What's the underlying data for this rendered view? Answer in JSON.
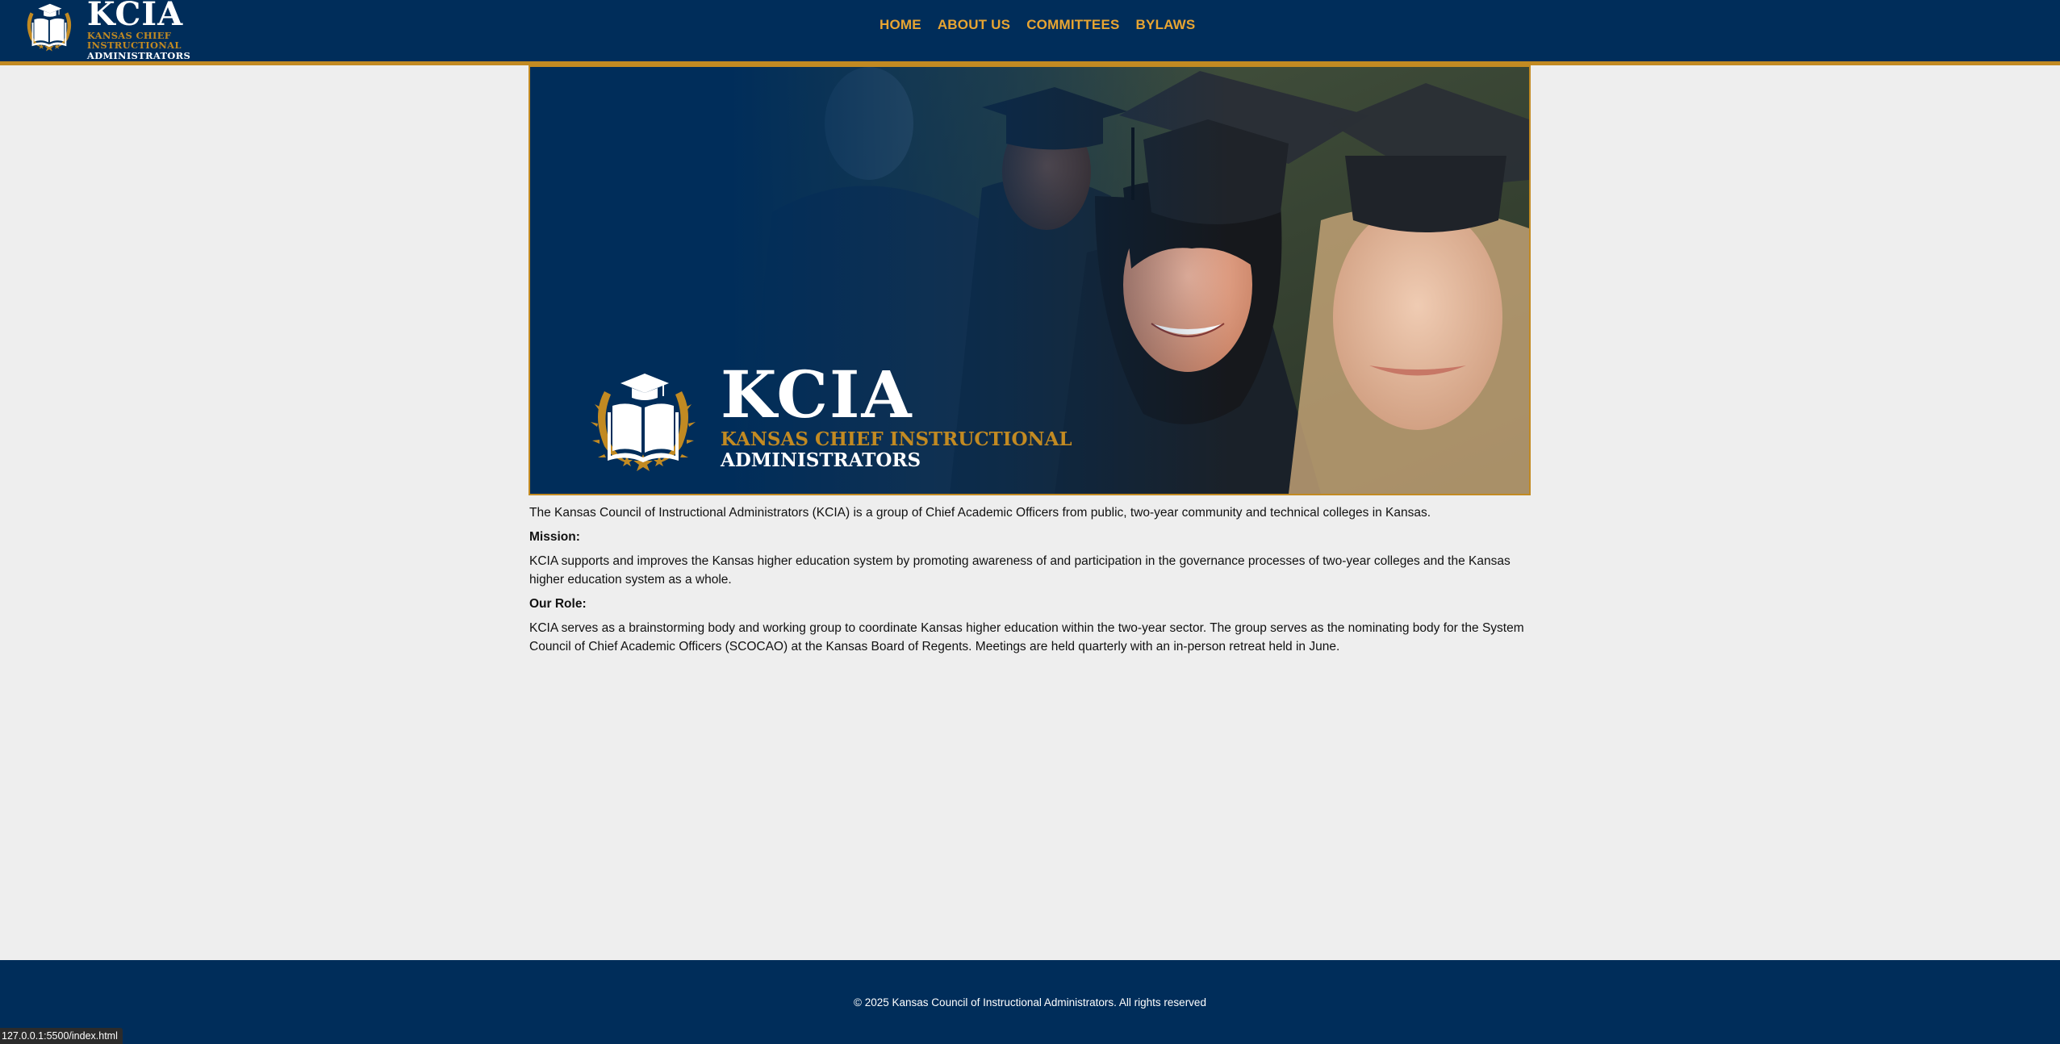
{
  "header": {
    "logo": {
      "name": "KCIA",
      "tagline_line1": "KANSAS CHIEF INSTRUCTIONAL",
      "tagline_line2": "ADMINISTRATORS"
    },
    "nav": [
      {
        "label": "HOME"
      },
      {
        "label": "ABOUT US"
      },
      {
        "label": "COMMITTEES"
      },
      {
        "label": "BYLAWS"
      }
    ]
  },
  "hero": {
    "name": "KCIA",
    "tagline_line1": "KANSAS CHIEF INSTRUCTIONAL",
    "tagline_line2": "ADMINISTRATORS"
  },
  "content": {
    "intro": "The Kansas Council of Instructional Administrators (KCIA) is a group of Chief Academic Officers from public, two-year community and technical colleges in Kansas.",
    "mission_heading": "Mission:",
    "mission_text": "KCIA supports and improves the Kansas higher education system by promoting awareness of and participation in the governance processes of two-year colleges and the Kansas higher education system as a whole.",
    "role_heading": "Our Role:",
    "role_text": "KCIA serves as a brainstorming body and working group to coordinate Kansas higher education within the two-year sector. The group serves as the nominating body for the System Council of Chief Academic Officers (SCOCAO) at the Kansas Board of Regents. Meetings are held quarterly with an in-person retreat held in June."
  },
  "footer": {
    "copyright": "© 2025 Kansas Council of Instructional Administrators. All rights reserved"
  },
  "status_bar": {
    "url": "127.0.0.1:5500/index.html"
  },
  "colors": {
    "navy": "#002d5a",
    "gold": "#c28a22",
    "nav_text": "#e8a531",
    "page_background": "#eeeeee"
  }
}
